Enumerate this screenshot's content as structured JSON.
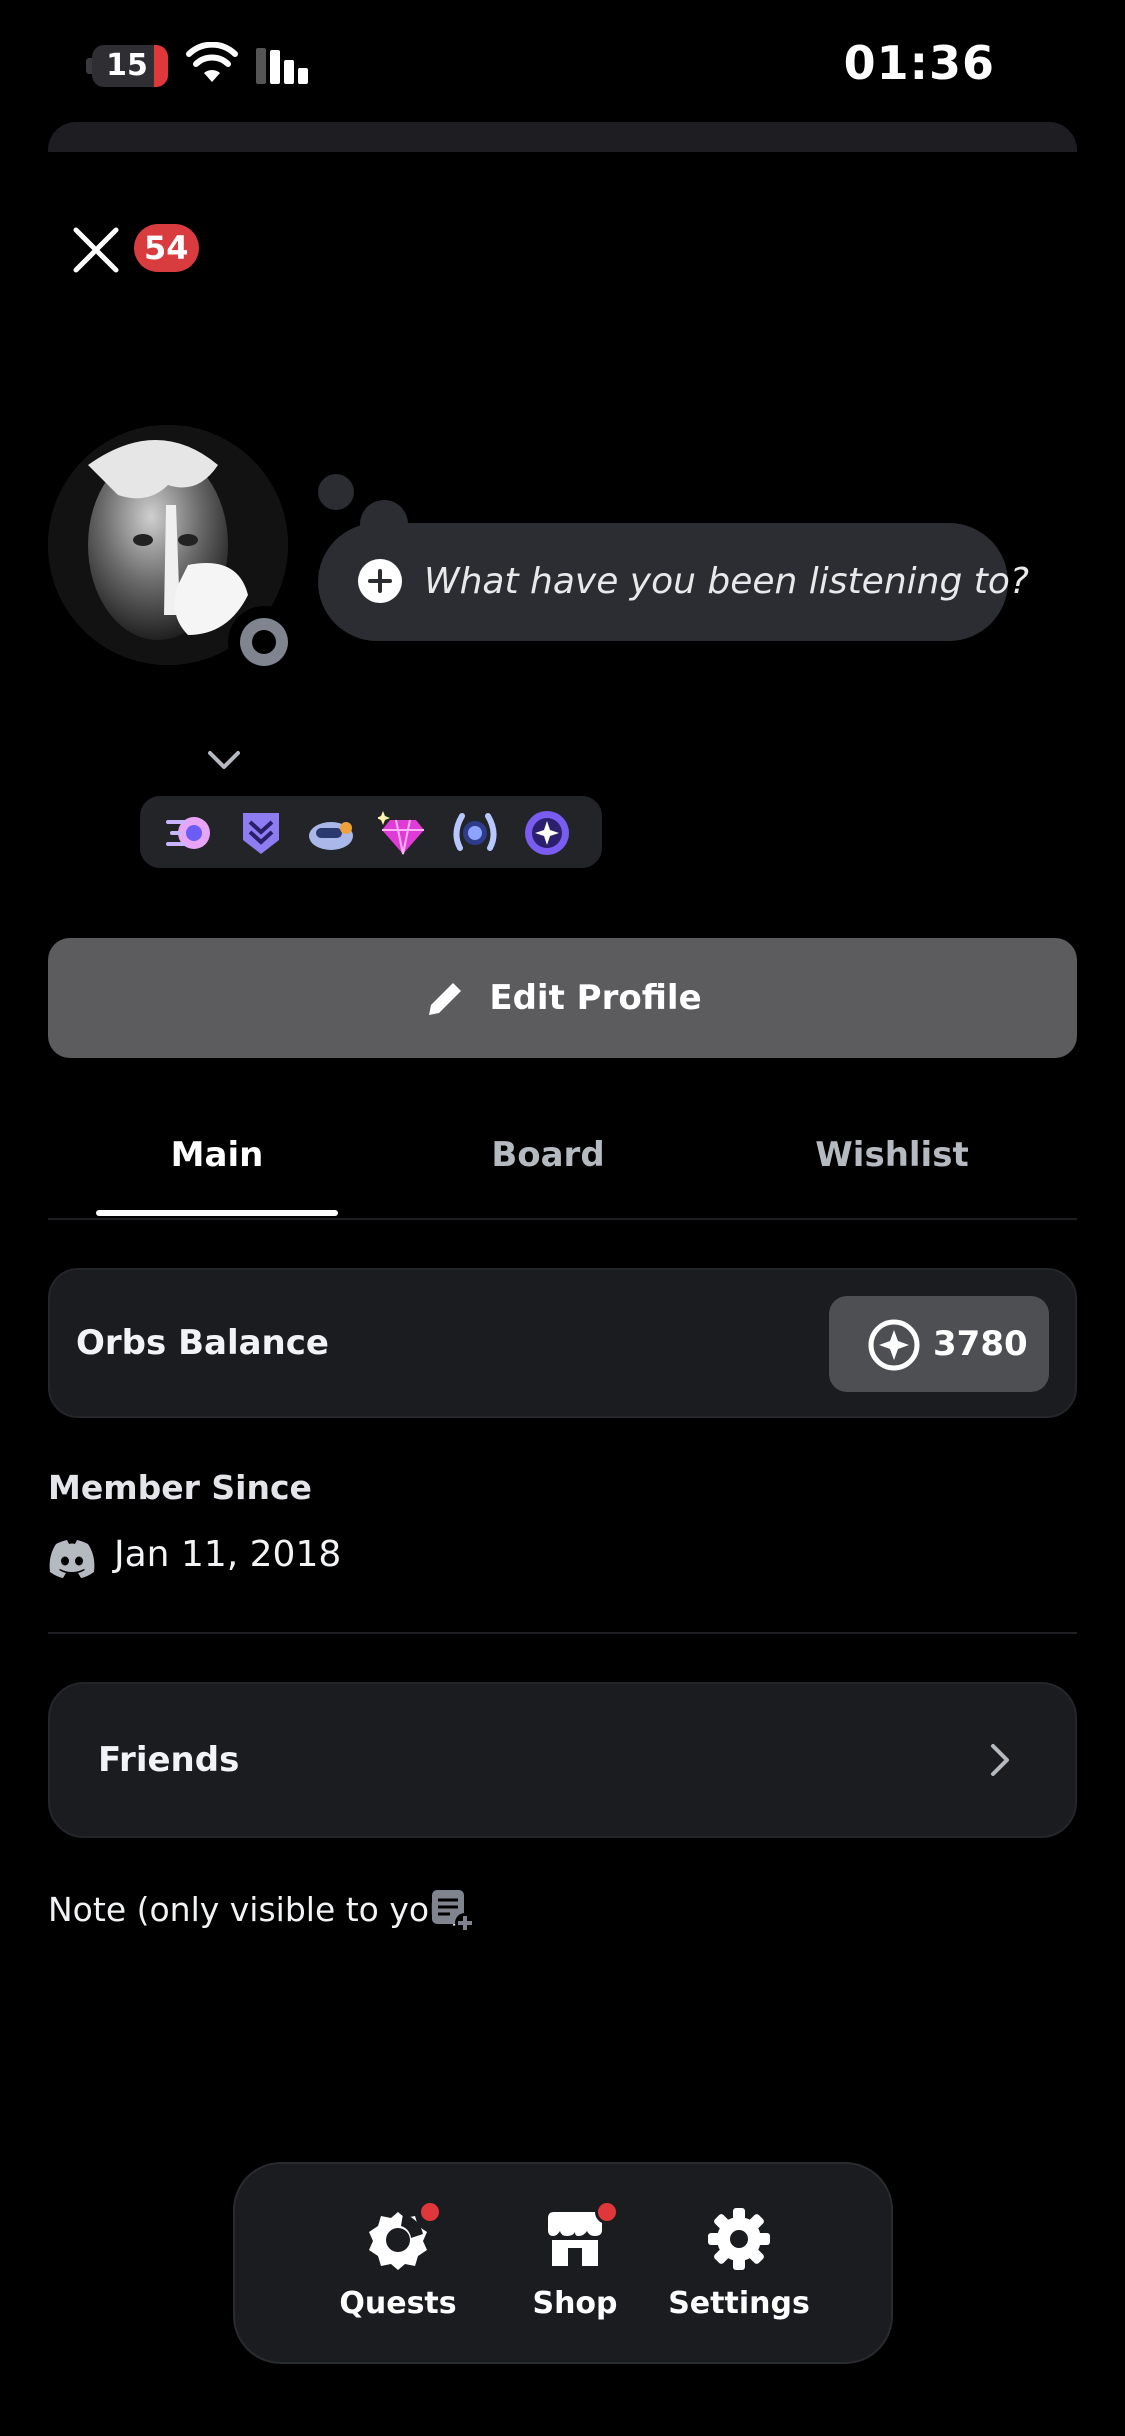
{
  "status_bar": {
    "battery_level": "15",
    "time": "01:36"
  },
  "header": {
    "notification_count": "54"
  },
  "profile": {
    "custom_status_placeholder": "What have you been listening to?",
    "badges": [
      "nitro-badge",
      "hypesquad-badge",
      "quest-badge",
      "nitro-gem-badge",
      "laurel-badge",
      "orbs-badge"
    ]
  },
  "actions": {
    "edit_profile_label": "Edit Profile"
  },
  "tabs": [
    {
      "label": "Main",
      "active": true
    },
    {
      "label": "Board",
      "active": false
    },
    {
      "label": "Wishlist",
      "active": false
    }
  ],
  "orbs": {
    "label": "Orbs Balance",
    "value": "3780"
  },
  "member": {
    "label": "Member Since",
    "date": "Jan 11, 2018"
  },
  "friends": {
    "label": "Friends"
  },
  "note": {
    "label": "Note (only visible to you)"
  },
  "bottom_nav": [
    {
      "label": "Quests",
      "icon": "quests-icon",
      "has_dot": true
    },
    {
      "label": "Shop",
      "icon": "shop-icon",
      "has_dot": true
    },
    {
      "label": "Settings",
      "icon": "gear-icon",
      "has_dot": false
    }
  ],
  "colors": {
    "background": "#000000",
    "accent_red": "#d83c3e",
    "card": "#1b1c1f",
    "button": "#5c5c5f"
  }
}
